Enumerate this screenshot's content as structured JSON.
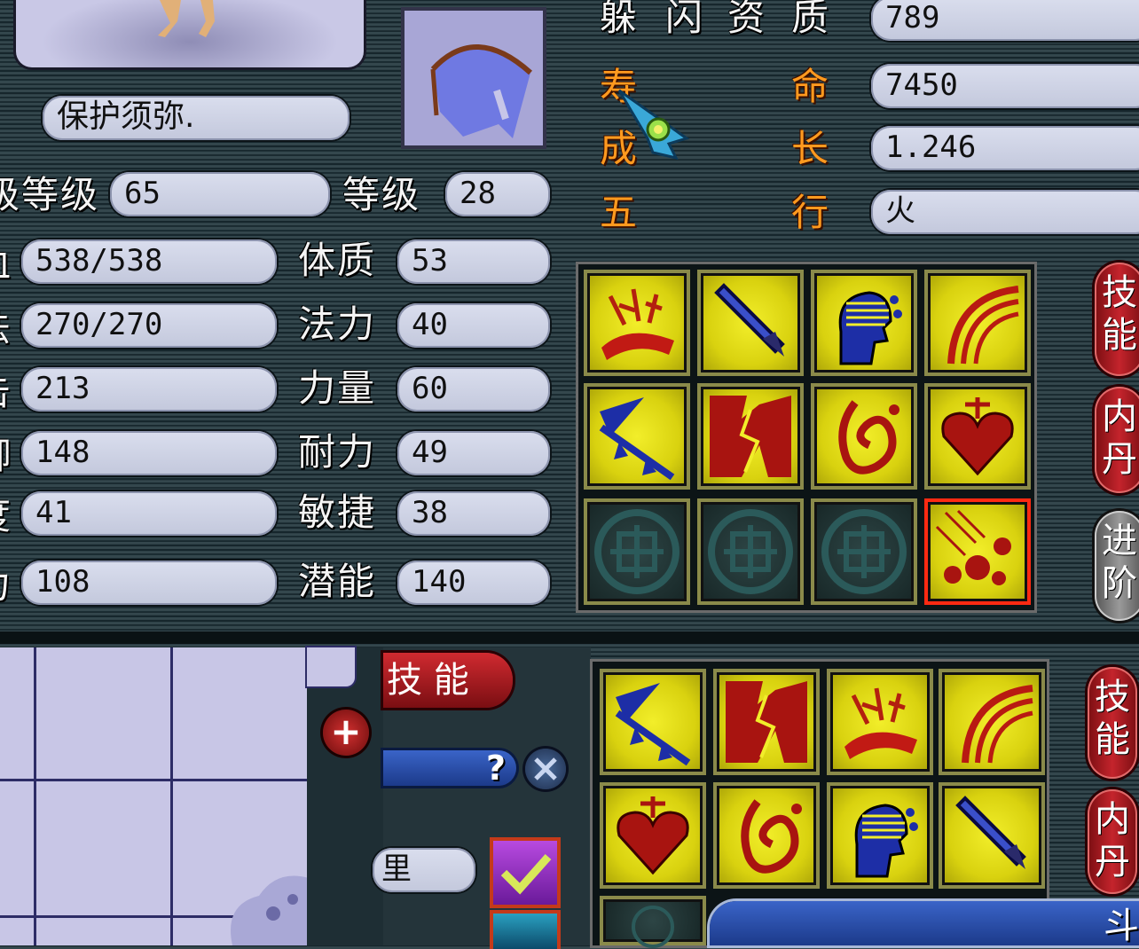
{
  "pet": {
    "name": "保护须弥.",
    "take_level_label": "级等级",
    "take_level": "65",
    "level_label": "等级",
    "level": "28"
  },
  "left_stats": [
    {
      "label": "血",
      "value": "538/538"
    },
    {
      "label": "法",
      "value": "270/270"
    },
    {
      "label": "击",
      "value": "213"
    },
    {
      "label": "御",
      "value": "148"
    },
    {
      "label": "度",
      "value": "41"
    },
    {
      "label": "力",
      "value": "108"
    }
  ],
  "attributes": [
    {
      "label": "体质",
      "value": "53"
    },
    {
      "label": "法力",
      "value": "40"
    },
    {
      "label": "力量",
      "value": "60"
    },
    {
      "label": "耐力",
      "value": "49"
    },
    {
      "label": "敏捷",
      "value": "38"
    },
    {
      "label": "潜能",
      "value": "140"
    }
  ],
  "aptitudes": [
    {
      "label": [
        "躲",
        "闪",
        "资",
        "质"
      ],
      "value": "789"
    },
    {
      "label": [
        "寿",
        "命"
      ],
      "value": "7450"
    },
    {
      "label": [
        "成",
        "长"
      ],
      "value": "1.246"
    },
    {
      "label": [
        "五",
        "行"
      ],
      "value": "火"
    }
  ],
  "top_skills": [
    "blood-claw",
    "sword",
    "mind",
    "arc-strike",
    "spear-gold",
    "burst",
    "flame-rune",
    "heart-guard",
    "empty",
    "empty",
    "empty",
    "meteor-fire"
  ],
  "selected_skill_index": 11,
  "bottom_skills": [
    "spear-gold",
    "burst",
    "blood-claw",
    "arc-strike",
    "heart-guard",
    "flame-rune",
    "mind",
    "sword"
  ],
  "side_tabs_top": [
    "技能",
    "内丹",
    "进阶"
  ],
  "side_tabs_bottom": [
    "技能",
    "内丹"
  ],
  "bottom_panel": {
    "skill_tab_label": "技 能",
    "help_label": "?",
    "partial_label": "里",
    "partial_right_label": "斗"
  },
  "colors": {
    "tab_red": "#c4242c",
    "slot_yellow": "#e3dc14",
    "selected_border": "#ff2a12",
    "label_orange": "#ff9a1f"
  }
}
